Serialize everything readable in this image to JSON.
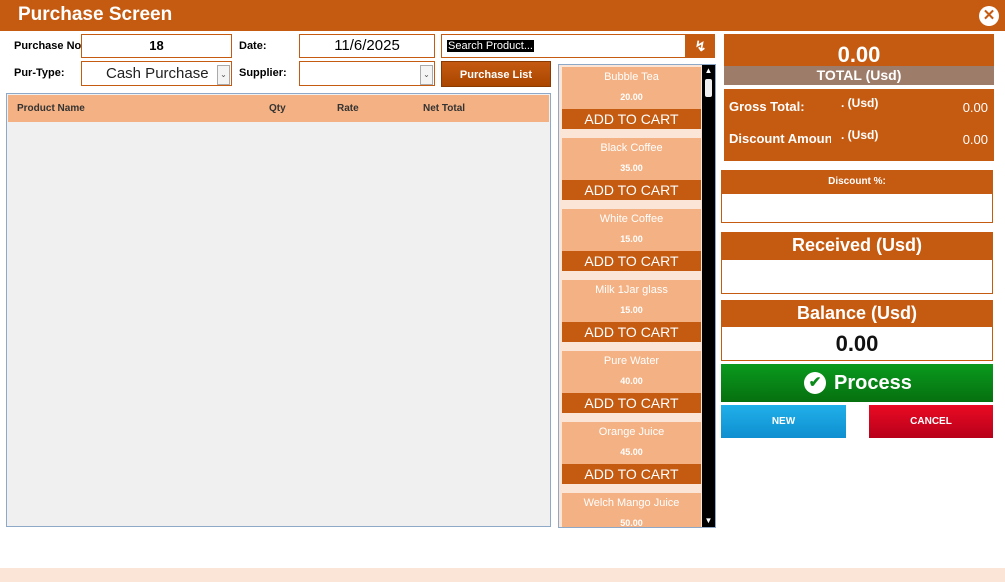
{
  "window": {
    "title": "Purchase Screen",
    "close_glyph": "✕"
  },
  "form": {
    "purchase_no_label": "Purchase No:",
    "purchase_no_value": "18",
    "date_label": "Date:",
    "date_value": "11/6/2025",
    "pur_type_label": "Pur-Type:",
    "pur_type_value": "Cash Purchase",
    "supplier_label": "Supplier:",
    "supplier_value": ""
  },
  "search": {
    "value": "Search Product...",
    "refresh_glyph": "↯"
  },
  "purchase_list_label": "Purchase List",
  "grid": {
    "columns": [
      "Product Name",
      "Qty",
      "Rate",
      "Net Total"
    ]
  },
  "products": [
    {
      "name": "Bubble Tea",
      "price": "20.00",
      "button": "ADD TO CART"
    },
    {
      "name": "Black Coffee",
      "price": "35.00",
      "button": "ADD TO CART"
    },
    {
      "name": "White Coffee",
      "price": "15.00",
      "button": "ADD TO CART"
    },
    {
      "name": "Milk 1Jar glass",
      "price": "15.00",
      "button": "ADD TO CART"
    },
    {
      "name": "Pure Water",
      "price": "40.00",
      "button": "ADD TO CART"
    },
    {
      "name": "Orange Juice",
      "price": "45.00",
      "button": "ADD TO CART"
    },
    {
      "name": "Welch Mango Juice",
      "price": "50.00",
      "button": ""
    }
  ],
  "totals": {
    "total_value": "0.00",
    "total_label": "TOTAL (Usd)",
    "gross_label": "Gross Total:",
    "gross_unit": ". (Usd)",
    "gross_value": "0.00",
    "discount_label": "Discount Amount",
    "discount_unit": ". (Usd)",
    "discount_value": "0.00",
    "discount_pct_label": "Discount %:",
    "received_label": "Received (Usd)",
    "balance_label": "Balance (Usd)",
    "balance_value": "0.00"
  },
  "actions": {
    "process_label": "Process",
    "new_label": "NEW",
    "cancel_label": "CANCEL"
  },
  "colors": {
    "accent": "#c55a11",
    "accent_light": "#f4b183",
    "process": "#0a8a18",
    "new": "#1ca6e0",
    "cancel": "#d4001e"
  }
}
